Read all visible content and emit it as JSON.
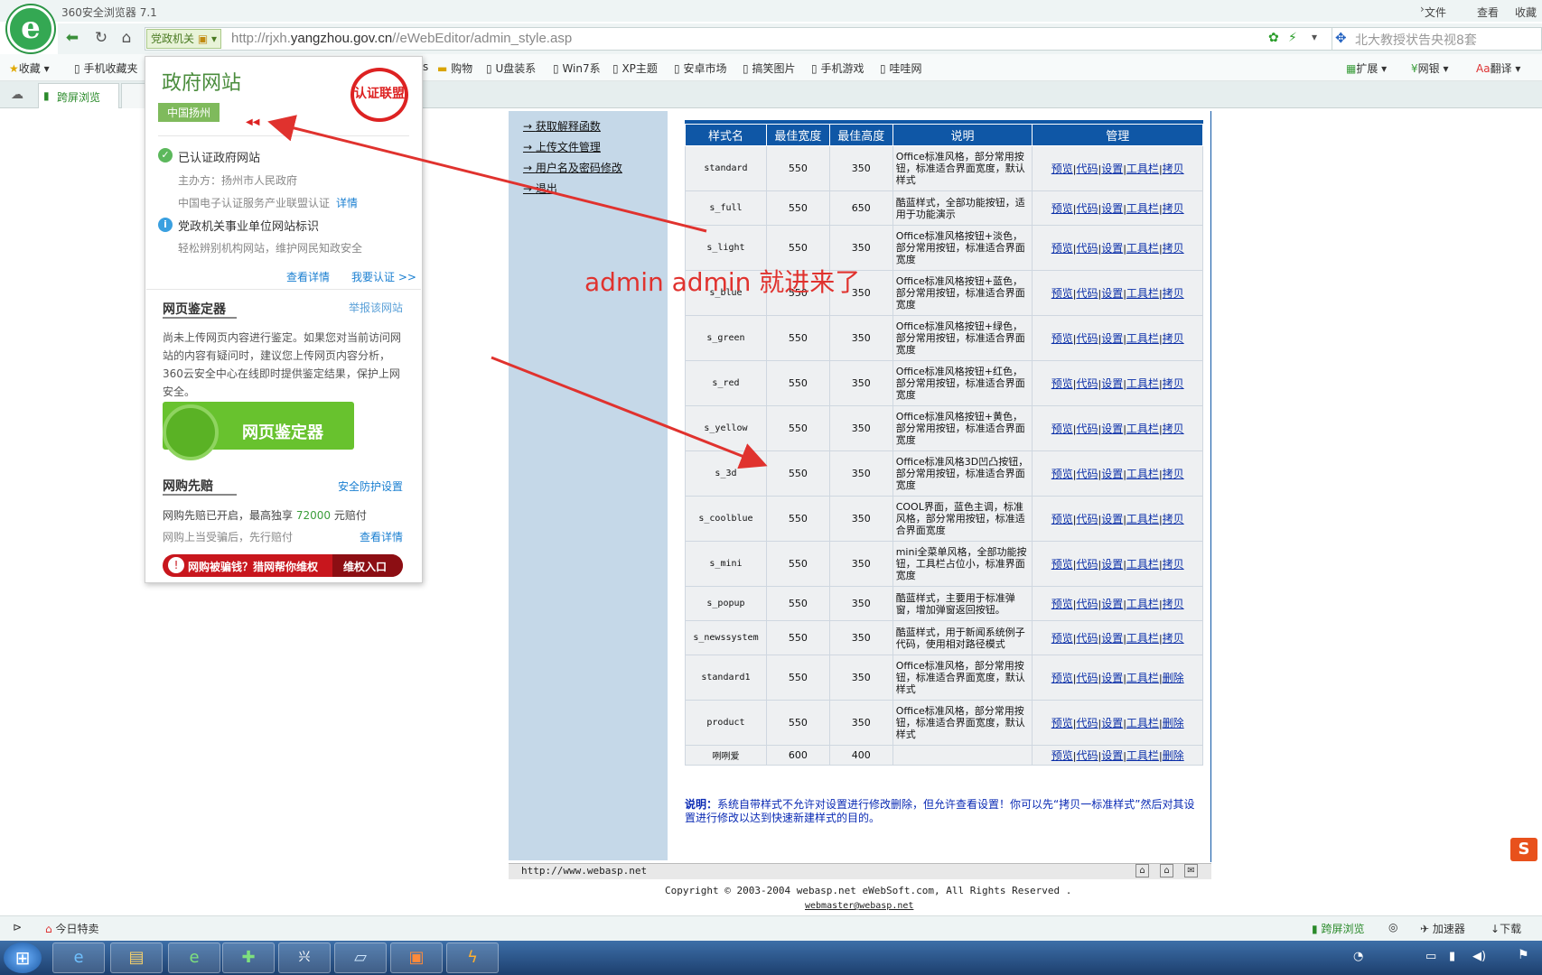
{
  "browser": {
    "title": "360安全浏览器 7.1",
    "menu": {
      "file": "文件",
      "view": "查看",
      "favorites": "收藏"
    },
    "dept_badge": "党政机关",
    "url_prefix": "http://rjxh.",
    "url_domain": "yangzhou.gov.cn",
    "url_path": "//eWebEditor/admin_style.asp",
    "search_text": "北大教授状告央视8套",
    "bookmarks": [
      "收藏",
      "手机收藏夹",
      "s",
      "购物",
      "U盘装系",
      "Win7系",
      "XP主题",
      "安卓市场",
      "搞笑图片",
      "手机游戏",
      "哇哇网"
    ],
    "toolbar_right": [
      "扩展",
      "网银",
      "翻译"
    ],
    "tab_label": "跨屏浏览"
  },
  "popup": {
    "title": "政府网站",
    "place": "中国扬州",
    "seal_text": "认证联盟",
    "verified": "已认证政府网站",
    "sponsor": "主办方：扬州市人民政府",
    "cert": "中国电子认证服务产业联盟认证",
    "cert_link": "详情",
    "mark_title": "党政机关事业单位网站标识",
    "mark_sub": "轻松辨别机构网站，维护网民知政安全",
    "view_details": "查看详情",
    "i_certify": "我要认证 >>",
    "appraiser_title": "网页鉴定器",
    "report_link": "举报该网站",
    "appraiser_desc": "尚未上传网页内容进行鉴定。如果您对当前访问网站的内容有疑问时，建议您上传网页内容分析，360云安全中心在线即时提供鉴定结果，保护上网安全。",
    "appraiser_button": "网页鉴定器",
    "shopping_title": "网购先赔",
    "security_settings": "安全防护设置",
    "shopping_desc_a": "网购先赔已开启，最高独享 ",
    "shopping_amount": "72000",
    "shopping_desc_b": " 元赔付",
    "shopping_sub": "网购上当受骗后，先行赔付",
    "shopping_details": "查看详情",
    "claim_text": "网购被骗钱？猎网帮你维权",
    "claim_entry": "维权入口"
  },
  "leftnav": [
    "获取解释函数",
    "上传文件管理",
    "用户名及密码修改",
    "退出"
  ],
  "table": {
    "headers": [
      "样式名",
      "最佳宽度",
      "最佳高度",
      "说明",
      "管理"
    ],
    "rows": [
      {
        "name": "standard",
        "w": "550",
        "h": "350",
        "desc": "Office标准风格，部分常用按钮，标准适合界面宽度，默认样式",
        "del": "拷贝"
      },
      {
        "name": "s_full",
        "w": "550",
        "h": "650",
        "desc": "酷蓝样式，全部功能按钮，适用于功能演示",
        "del": "拷贝"
      },
      {
        "name": "s_light",
        "w": "550",
        "h": "350",
        "desc": "Office标准风格按钮+淡色，部分常用按钮，标准适合界面宽度",
        "del": "拷贝"
      },
      {
        "name": "s_blue",
        "w": "550",
        "h": "350",
        "desc": "Office标准风格按钮+蓝色，部分常用按钮，标准适合界面宽度",
        "del": "拷贝"
      },
      {
        "name": "s_green",
        "w": "550",
        "h": "350",
        "desc": "Office标准风格按钮+绿色，部分常用按钮，标准适合界面宽度",
        "del": "拷贝"
      },
      {
        "name": "s_red",
        "w": "550",
        "h": "350",
        "desc": "Office标准风格按钮+红色，部分常用按钮，标准适合界面宽度",
        "del": "拷贝"
      },
      {
        "name": "s_yellow",
        "w": "550",
        "h": "350",
        "desc": "Office标准风格按钮+黄色，部分常用按钮，标准适合界面宽度",
        "del": "拷贝"
      },
      {
        "name": "s_3d",
        "w": "550",
        "h": "350",
        "desc": "Office标准风格3D凹凸按钮，部分常用按钮，标准适合界面宽度",
        "del": "拷贝"
      },
      {
        "name": "s_coolblue",
        "w": "550",
        "h": "350",
        "desc": "COOL界面，蓝色主调，标准风格，部分常用按钮，标准适合界面宽度",
        "del": "拷贝"
      },
      {
        "name": "s_mini",
        "w": "550",
        "h": "350",
        "desc": "mini全菜单风格，全部功能按钮，工具栏占位小，标准界面宽度",
        "del": "拷贝"
      },
      {
        "name": "s_popup",
        "w": "550",
        "h": "350",
        "desc": "酷蓝样式，主要用于标准弹窗，增加弹窗返回按钮。",
        "del": "拷贝"
      },
      {
        "name": "s_newssystem",
        "w": "550",
        "h": "350",
        "desc": "酷蓝样式，用于新闻系统例子代码，使用相对路径模式",
        "del": "拷贝"
      },
      {
        "name": "standard1",
        "w": "550",
        "h": "350",
        "desc": "Office标准风格，部分常用按钮，标准适合界面宽度，默认样式",
        "del": "删除"
      },
      {
        "name": "product",
        "w": "550",
        "h": "350",
        "desc": "Office标准风格，部分常用按钮，标准适合界面宽度，默认样式",
        "del": "删除"
      },
      {
        "name": "咧咧爱",
        "w": "600",
        "h": "400",
        "desc": "",
        "del": "删除"
      }
    ],
    "ops": [
      "预览",
      "代码",
      "设置",
      "工具栏"
    ]
  },
  "note_label": "说明：",
  "note_text": "系统自带样式不允许对设置进行修改删除，但允许查看设置！你可以先“拷贝一标准样式”然后对其设置进行修改以达到快速新建样式的目的。",
  "footer": {
    "url": "http://www.webasp.net",
    "copyright": "Copyright © 2003-2004 webasp.net eWebSoft.com, All Rights Reserved .",
    "webmaster": "webmaster@webasp.net"
  },
  "annotation": "admin admin 就进来了",
  "statusbar": {
    "today": "今日特卖",
    "cross_screen": "跨屏浏览",
    "accelerator": "加速器",
    "download": "下载"
  },
  "colors": {
    "header_blue": "#0f57a6",
    "accent_green": "#4a8c3c",
    "annotation_red": "#e0322e"
  }
}
